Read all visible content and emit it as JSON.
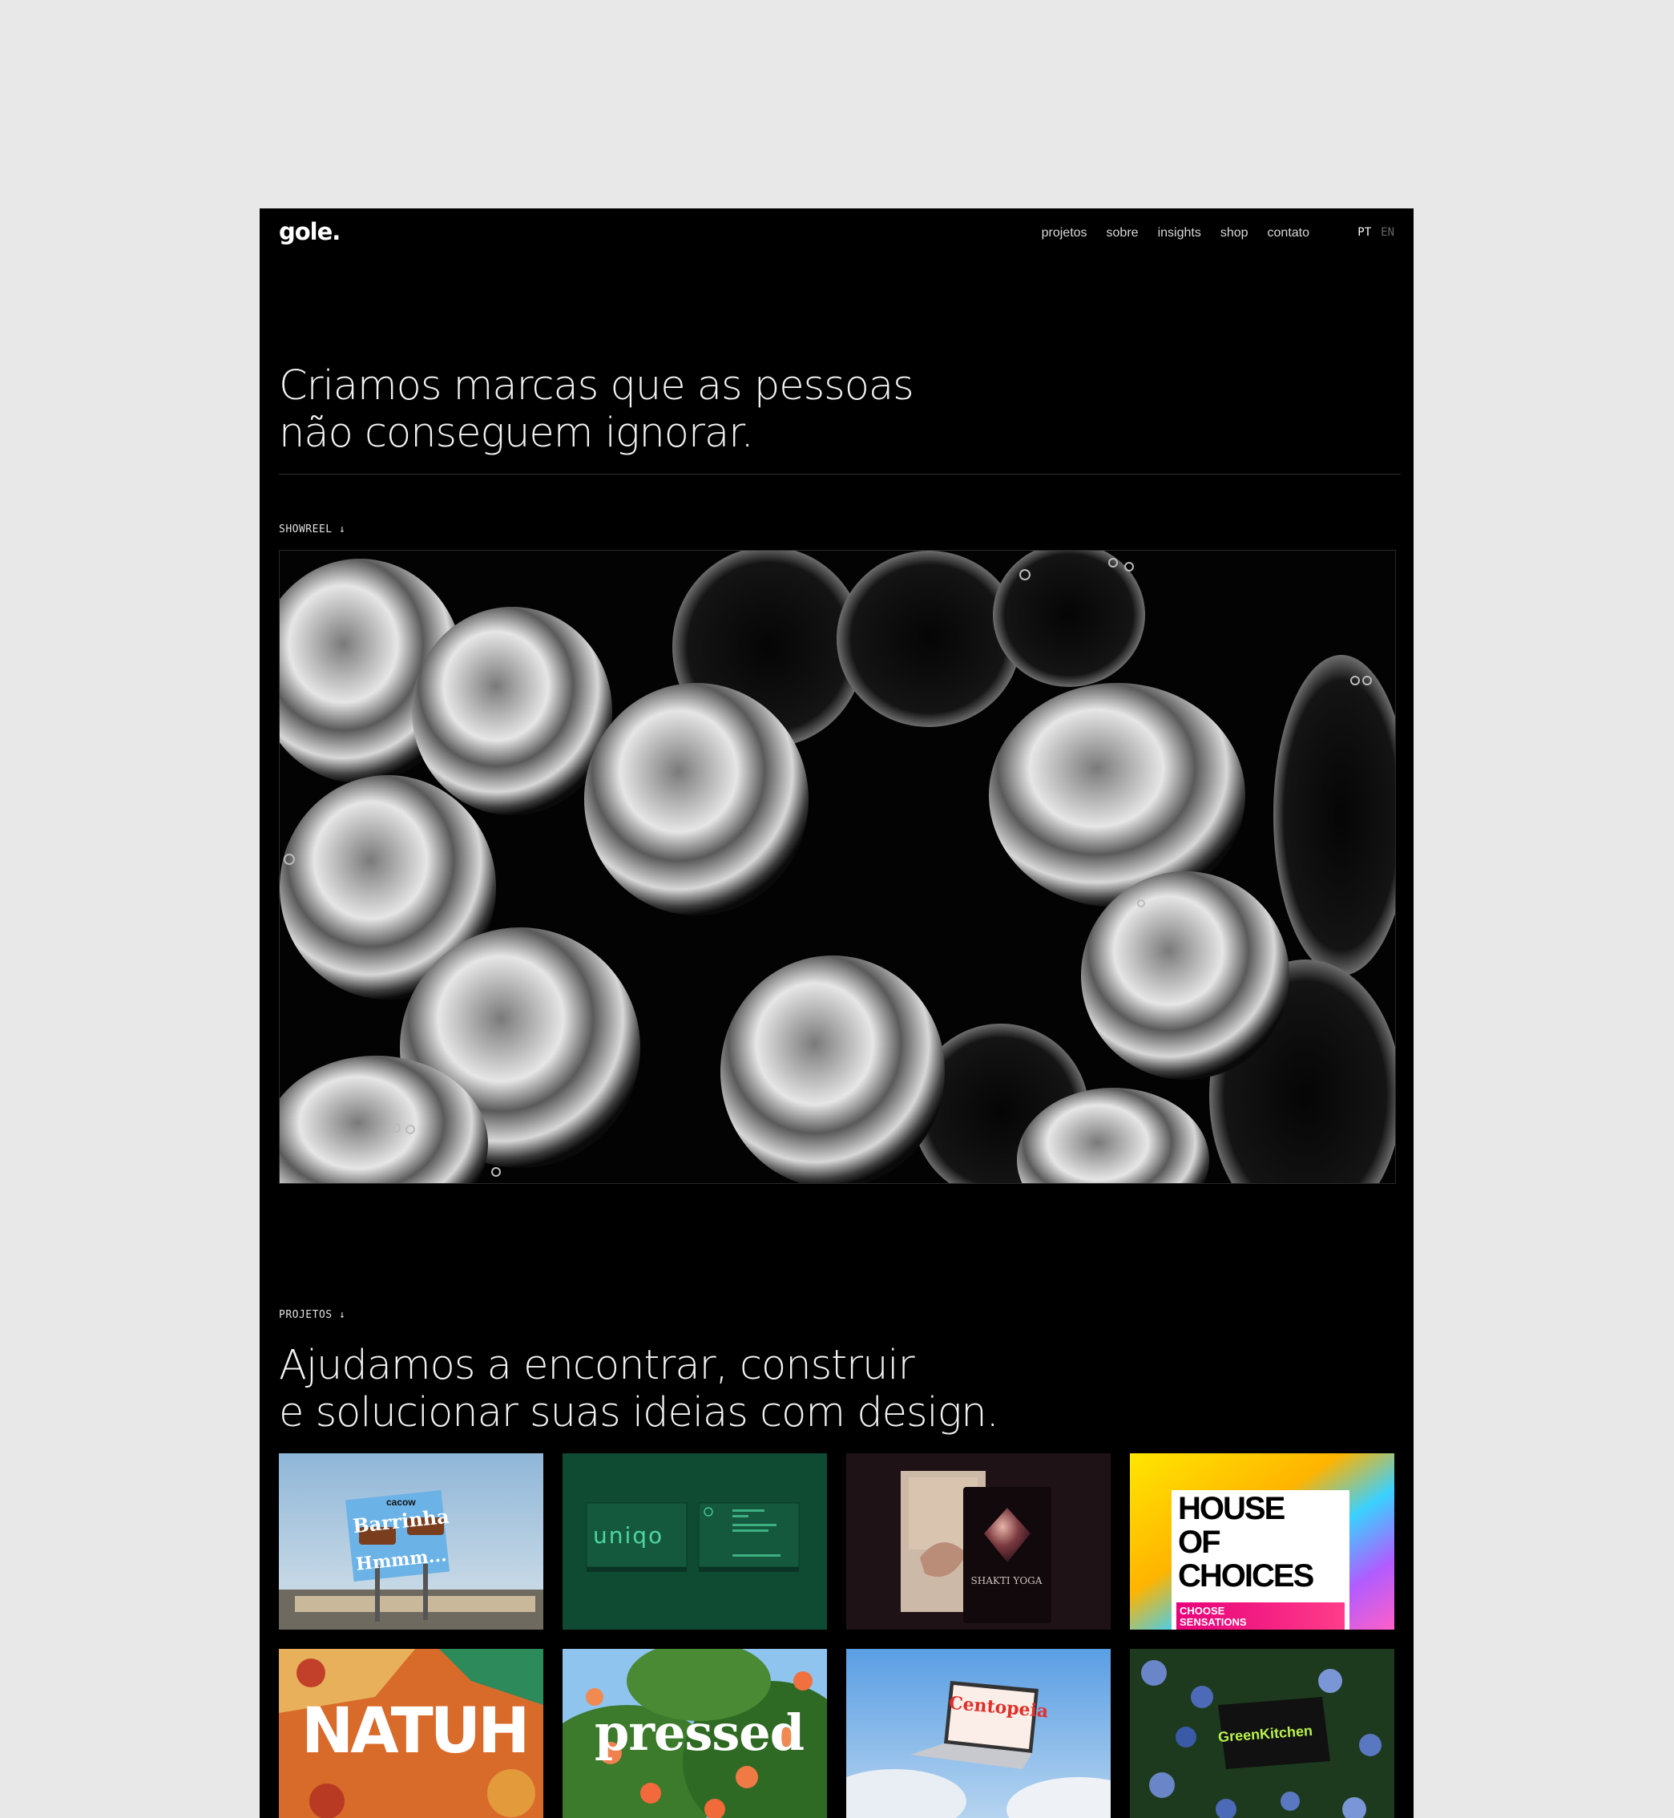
{
  "header": {
    "logo": "gole.",
    "nav": [
      "projetos",
      "sobre",
      "insights",
      "shop",
      "contato"
    ],
    "lang": {
      "active": "PT",
      "inactive": "EN"
    }
  },
  "hero": {
    "title": "Criamos marcas que as pessoas\nnão conseguem ignorar."
  },
  "showreel": {
    "label": "SHOWREEL ↓"
  },
  "projects": {
    "label": "PROJETOS ↓",
    "title": "Ajudamos a encontrar, construir\ne solucionar suas ideias com design.",
    "cards": [
      {
        "brand": "cacow",
        "headline": "Barrinha",
        "sub": "Hmmm..."
      },
      {
        "brand": "uniqo"
      },
      {
        "brand": "SHAKTI YOGA"
      },
      {
        "brand": "HOUSE OF CHOICES",
        "line1": "HOUSE",
        "line2": "OF",
        "line3": "CHOICES",
        "tag": "CHOOSE SENSATIONS"
      },
      {
        "brand": "NATUH"
      },
      {
        "brand": "pressed"
      },
      {
        "brand": "Centopeia"
      },
      {
        "brand": "GreenKitchen"
      }
    ]
  },
  "colors": {
    "page_bg": "#e8e8e8",
    "site_bg": "#000000",
    "uniqo_green": "#0f4a33",
    "shakti_bg": "#1e1216"
  }
}
